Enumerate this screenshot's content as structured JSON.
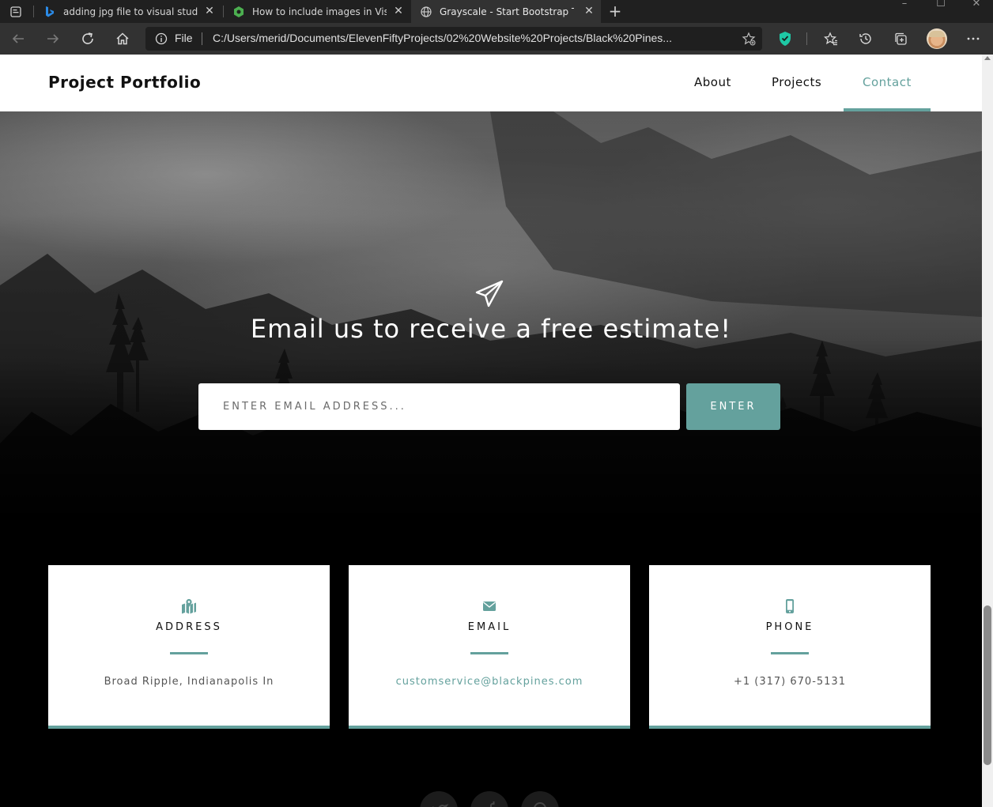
{
  "browser": {
    "tabs": [
      {
        "title": "adding jpg file to visual studio co",
        "icon": "bing-icon",
        "active": false
      },
      {
        "title": "How to include images in Visual",
        "icon": "site-icon",
        "active": false
      },
      {
        "title": "Grayscale - Start Bootstrap Them",
        "icon": "globe-icon",
        "active": true
      }
    ],
    "url_scheme": "File",
    "url": "C:/Users/merid/Documents/ElevenFiftyProjects/02%20Website%20Projects/Black%20Pines..."
  },
  "site": {
    "brand": "Project Portfolio",
    "nav": [
      {
        "label": "About",
        "active": false
      },
      {
        "label": "Projects",
        "active": false
      },
      {
        "label": "Contact",
        "active": true
      }
    ],
    "accent_color": "#64a19d"
  },
  "signup": {
    "icon": "paper-plane-icon",
    "heading": "Email us to receive a free estimate!",
    "input_placeholder": "ENTER EMAIL ADDRESS...",
    "button_label": "ENTER"
  },
  "contact_cards": [
    {
      "icon": "map-marked-icon",
      "title": "ADDRESS",
      "text": "Broad Ripple, Indianapolis In"
    },
    {
      "icon": "envelope-icon",
      "title": "EMAIL",
      "text": "customservice@blackpines.com"
    },
    {
      "icon": "mobile-phone-icon",
      "title": "PHONE",
      "text": "+1 (317) 670-5131"
    }
  ]
}
